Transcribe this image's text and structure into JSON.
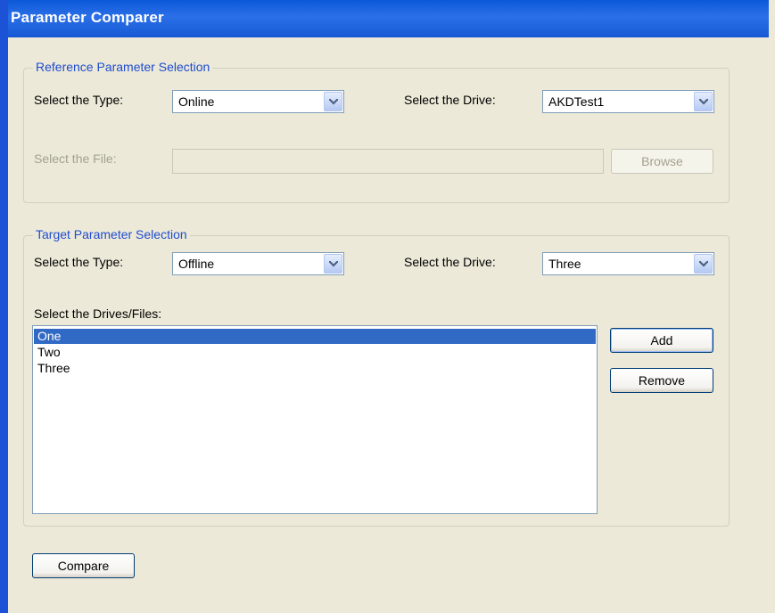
{
  "window": {
    "title": "Parameter Comparer"
  },
  "reference": {
    "legend": "Reference Parameter Selection",
    "type_label": "Select the Type:",
    "type_value": "Online",
    "drive_label": "Select the Drive:",
    "drive_value": "AKDTest1",
    "file_label": "Select the File:",
    "file_value": "",
    "browse_label": "Browse"
  },
  "target": {
    "legend": "Target Parameter Selection",
    "type_label": "Select the Type:",
    "type_value": "Offline",
    "drive_label": "Select the Drive:",
    "drive_value": "Three",
    "list_label": "Select the Drives/Files:",
    "list_items": [
      "One",
      "Two",
      "Three"
    ],
    "selected_item": "One",
    "add_label": "Add",
    "remove_label": "Remove"
  },
  "compare_label": "Compare",
  "colors": {
    "title_bar": "#1558d4",
    "legend_text": "#1f4cd0",
    "selection": "#316ac5",
    "background": "#ece9d8"
  }
}
